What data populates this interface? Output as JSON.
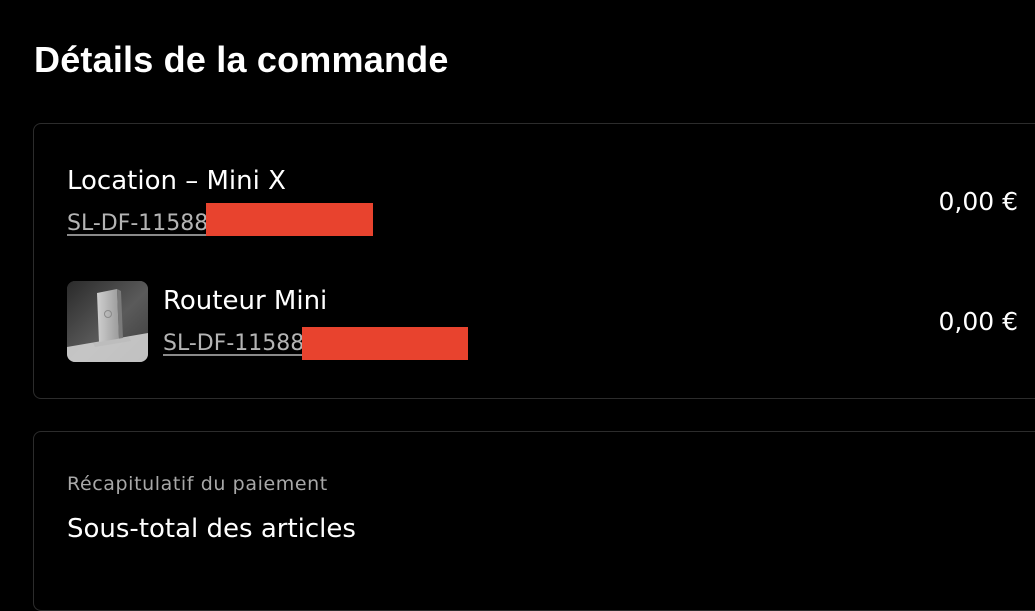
{
  "page": {
    "title": "Détails de la commande"
  },
  "order_items": [
    {
      "name": "Location – Mini X",
      "sku": "SL-DF-11588",
      "price": "0,00 €",
      "has_image": false
    },
    {
      "name": "Routeur Mini",
      "sku": "SL-DF-11588",
      "price": "0,00 €",
      "has_image": true,
      "image_icon": "router-product-image"
    }
  ],
  "payment_summary": {
    "heading": "Récapitulatif du paiement",
    "subtotal_label": "Sous-total des articles"
  },
  "colors": {
    "background": "#000000",
    "text": "#ffffff",
    "muted_text": "#a8a8a8",
    "card_border": "#2c2c2c",
    "redaction": "#e8432e"
  }
}
